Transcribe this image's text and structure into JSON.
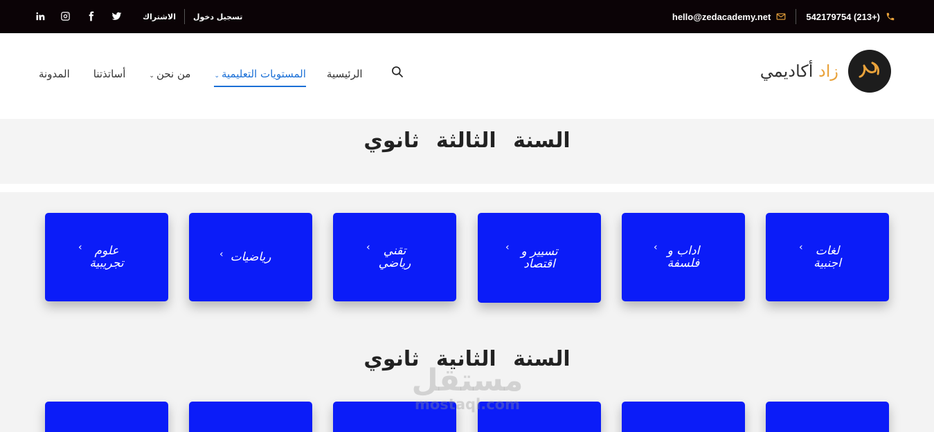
{
  "topbar": {
    "auth": {
      "login": "تسجيل دخول",
      "subscribe": "الاشتراك"
    },
    "contact": {
      "email": "hello@zedacademy.net",
      "phone": "542179754 (213+)"
    },
    "social": [
      "linkedin-icon",
      "instagram-icon",
      "facebook-icon",
      "twitter-icon"
    ],
    "colors": {
      "background": "#0b0306",
      "accent": "#e9a23b"
    }
  },
  "header": {
    "brand": {
      "first": "زاد",
      "second": "أكاديمي"
    },
    "nav": [
      {
        "label": "الرئيسية",
        "has_dropdown": false,
        "active": false
      },
      {
        "label": "المستويات التعليمية",
        "has_dropdown": true,
        "active": true
      },
      {
        "label": "من نحن",
        "has_dropdown": true,
        "active": false
      },
      {
        "label": "أساتذتنا",
        "has_dropdown": false,
        "active": false
      },
      {
        "label": "المدونة",
        "has_dropdown": false,
        "active": false
      }
    ],
    "colors": {
      "active": "#1a6fd6"
    }
  },
  "sections": [
    {
      "title": "السنة الثالثة ثانوي",
      "cards": [
        {
          "label": "لغات اجنبية"
        },
        {
          "label": "اداب و فلسفة"
        },
        {
          "label": "تسيير و اقتصاد"
        },
        {
          "label": "تقني رياضي"
        },
        {
          "label": "رياضيات"
        },
        {
          "label": "علوم تجريبية"
        }
      ]
    },
    {
      "title": "السنة الثانية ثانوي"
    }
  ],
  "card_color": "#0b1cf8",
  "card_arrow": "‹",
  "watermark": {
    "arabic": "مستقل",
    "latin": "mostaql.com"
  }
}
